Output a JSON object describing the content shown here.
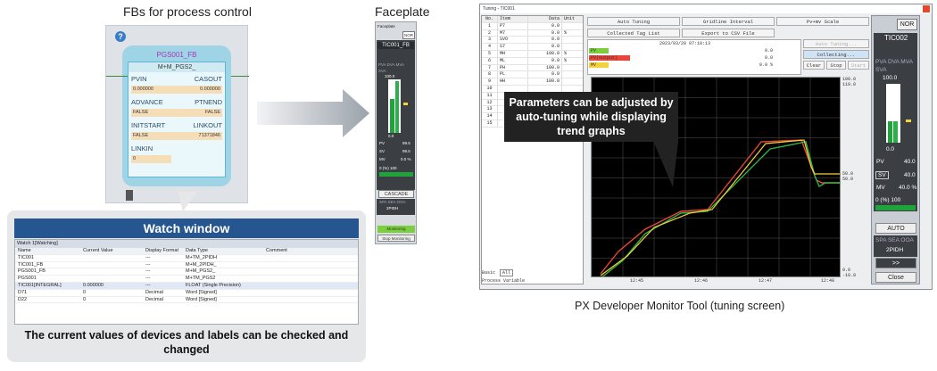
{
  "captions": {
    "fbs": "FBs for process control",
    "faceplate": "Faceplate",
    "watch_desc": "The current values of devices and labels can be checked and changed",
    "tool": "PX Developer Monitor Tool (tuning screen)"
  },
  "fb": {
    "instance": "PGS001_FB",
    "type": "M+M_PGS2_",
    "pins": [
      {
        "l": "PVIN",
        "r": "CASOUT",
        "vl": "0.000000",
        "vr": "0.000000"
      },
      {
        "l": "ADVANCE",
        "r": "PTNEND",
        "vl": "FALSE",
        "vr": "FALSE"
      },
      {
        "l": "INITSTART",
        "r": "LINKOUT",
        "vl": "FALSE",
        "vr": "71371846"
      },
      {
        "l": "LINKIN",
        "r": "",
        "vl": "0",
        "vr": ""
      }
    ]
  },
  "watch": {
    "header": "Watch window",
    "title": "Watch 1[Watching]",
    "cols": [
      "Name",
      "Current Value",
      "Display Format",
      "Data Type",
      "Comment"
    ],
    "rows": [
      [
        "TIC001",
        "",
        "---",
        "M+TM_2PIDH",
        ""
      ],
      [
        "TIC001_FB",
        "",
        "---",
        "M+M_2PIDH_",
        ""
      ],
      [
        "PGS001_FB",
        "",
        "---",
        "M+M_PGS2_",
        ""
      ],
      [
        "PGS001",
        "",
        "---",
        "M+TM_PGS2",
        ""
      ],
      [
        "TIC001[INTEGRAL]",
        "0.000000",
        "---",
        "FLOAT (Single Precision)",
        ""
      ],
      [
        "D71",
        "0",
        "Decimal",
        "Word [Signed]",
        ""
      ],
      [
        "D22",
        "0",
        "Decimal",
        "Word [Signed]",
        ""
      ]
    ]
  },
  "faceplate": {
    "win": "Faceplate",
    "tag": "TIC001_FB",
    "nor": "NOR",
    "modes": "PVA  DVA  MVA",
    "sva": "SVA",
    "scale": "100.0",
    "zero": "0.0",
    "pv": "PV",
    "pv_val": "99.5",
    "sv": "SV",
    "sv_val": "99.5",
    "mv": "MV",
    "mv_val": "0.0 %",
    "pct": "0  (%)  100",
    "cascade": "CASCADE",
    "spa": "SPA  SEA  OOA",
    "pidh": "2PIDH",
    "monitoring": "Monitoring",
    "stop": "Stop Monitoring"
  },
  "tuning": {
    "title": "Tuning - TIC001",
    "table_head": [
      "No.",
      "Item",
      "Data",
      "Unit"
    ],
    "rows": [
      [
        "1",
        "P7",
        "0.0",
        ""
      ],
      [
        "2",
        "M7",
        "0.0",
        "%"
      ],
      [
        "3",
        "SVO",
        "0.0",
        ""
      ],
      [
        "4",
        "S7",
        "0.0",
        ""
      ],
      [
        "5",
        "MH",
        "100.0",
        "%"
      ],
      [
        "6",
        "ML",
        "0.0",
        "%"
      ],
      [
        "7",
        "PH",
        "100.0",
        ""
      ],
      [
        "8",
        "PL",
        "0.0",
        ""
      ],
      [
        "9",
        "HH",
        "100.0",
        ""
      ],
      [
        "10",
        "",
        "",
        ""
      ],
      [
        "11",
        "",
        "",
        ""
      ],
      [
        "12",
        "",
        "",
        ""
      ],
      [
        "13",
        "",
        "",
        ""
      ],
      [
        "14",
        "",
        "",
        ""
      ],
      [
        "15",
        "",
        "",
        ""
      ]
    ],
    "basic": "Basic",
    "all": "All",
    "process_var": "Process Variable",
    "auto_tuning": "Auto Tuning",
    "gridline": "Gridline Interval",
    "pvmv": "Pv+mv Scale",
    "collected": "Collected Tag List",
    "export": "Export to CSV File",
    "datetime": "2023/03/20 07:10:13",
    "legend": [
      [
        "PV",
        "0.0"
      ],
      [
        "PV(output)",
        "0.0"
      ],
      [
        "MV",
        "0.0 %"
      ]
    ],
    "auto_restart": "Auto Tuning...",
    "collecting": "Collecting...",
    "clear": "Clear",
    "stop": "Stop",
    "start": "Start",
    "y_top": "100.0\n110.0",
    "y_mid": "50.0\n50.0",
    "y_bot": "0.0\n-10.0",
    "x_ticks": [
      "12:45",
      "12:46",
      "12:47",
      "12:48"
    ],
    "callout": "Parameters can be adjusted by auto-tuning while displaying trend graphs",
    "tag": "TIC002",
    "nor": "NOR",
    "modes": "PVA  DVA  MVA",
    "sva": "SVA",
    "scale": "100.0",
    "zero": "0.0",
    "pv": "PV",
    "pv_val": "40.0",
    "sv": "SV",
    "sv_val": "40.0",
    "mv": "MV",
    "mv_val": "40.0 %",
    "pct": "0  (%)  100",
    "auto": "AUTO",
    "spa": "SPA  SEA  OOA",
    "pidh": "2PIDH",
    "more": ">>",
    "close": "Close"
  }
}
